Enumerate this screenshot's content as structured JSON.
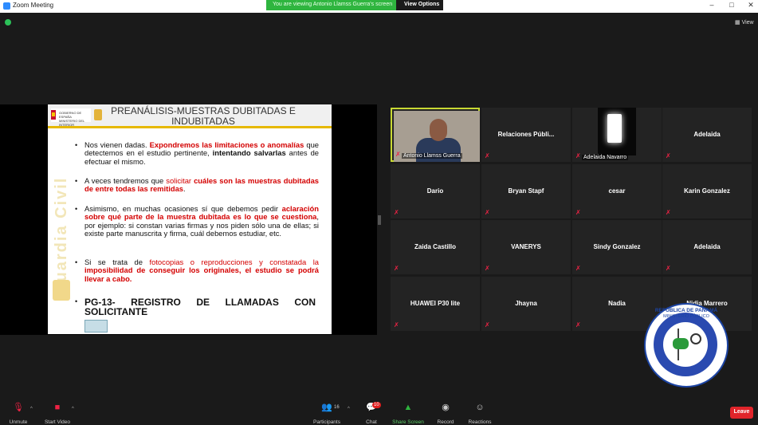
{
  "window": {
    "title": "Zoom Meeting"
  },
  "share_banner": {
    "text": "You are viewing Antonio Llamss Guerra's screen",
    "button": "View Options"
  },
  "gallery_toggle": "View",
  "slide": {
    "ministry": "GOBIERNO DE ESPAÑA MINISTERIO DEL INTERIOR",
    "title_line1": "PREANÁLISIS-MUESTRAS DUBITADAS E",
    "title_line2": "INDUBITADAS",
    "vertical_label": "Guardia Civil",
    "bullets": [
      {
        "parts": [
          {
            "t": "Nos vienen dadas. ",
            "s": ""
          },
          {
            "t": "Expondremos las limitaciones o anomalías",
            "s": "redb"
          },
          {
            "t": " que detectemos en el estudio pertinente, ",
            "s": ""
          },
          {
            "t": "intentando salvarlas",
            "s": "b"
          },
          {
            "t": " antes de efectuar el mismo.",
            "s": ""
          }
        ]
      },
      {
        "parts": [
          {
            "t": "A veces tendremos que ",
            "s": ""
          },
          {
            "t": "solicitar",
            "s": "red"
          },
          {
            "t": " ",
            "s": ""
          },
          {
            "t": "cuáles son las muestras dubitadas de entre todas las remitidas",
            "s": "redb"
          },
          {
            "t": ".",
            "s": ""
          }
        ]
      },
      {
        "parts": [
          {
            "t": "Asimismo, en muchas ocasiones sí que debemos pedir ",
            "s": ""
          },
          {
            "t": "aclaración sobre qué parte de la muestra dubitada es lo que se cuestiona",
            "s": "redb"
          },
          {
            "t": ", por ejemplo: si constan varias firmas y nos piden sólo una de ellas; si existe parte manuscrita y firma, cuál debemos estudiar, etc.",
            "s": ""
          }
        ]
      },
      {
        "parts": [
          {
            "t": "Si se trata de ",
            "s": ""
          },
          {
            "t": "fotocopias o reproducciones y constatada la",
            "s": "red"
          },
          {
            "t": " ",
            "s": ""
          },
          {
            "t": "imposibilidad de conseguir los originales, el estudio se podrá llevar a cabo.",
            "s": "redb"
          }
        ]
      }
    ],
    "pg_line": "PG-13- REGISTRO DE LLAMADAS CON SOLICITANTE",
    "bullet_char": "•"
  },
  "participants": [
    {
      "name": "Antonio Llamss Guerra",
      "video": true,
      "active": true
    },
    {
      "name": "Relaciones  Públi...",
      "video": false
    },
    {
      "name": "Adelaida Navarro",
      "video": true
    },
    {
      "name": "Adelaida",
      "video": false
    },
    {
      "name": "Dario",
      "video": false
    },
    {
      "name": "Bryan Stapf",
      "video": false
    },
    {
      "name": "cesar",
      "video": false
    },
    {
      "name": "Karin Gonzalez",
      "video": false
    },
    {
      "name": "Zaida Castillo",
      "video": false
    },
    {
      "name": "VANERYS",
      "video": false
    },
    {
      "name": "Sindy Gonzalez",
      "video": false
    },
    {
      "name": "Adelaida",
      "video": false
    },
    {
      "name": "HUAWEI P30 lite",
      "video": false
    },
    {
      "name": "Jhayna",
      "video": false
    },
    {
      "name": "Nadia",
      "video": false
    },
    {
      "name": "Nidia Marrero",
      "video": false
    }
  ],
  "seal": {
    "top": "REPÚBLICA DE PANAMÁ",
    "sub": "MINISTERIO PÚBLICO"
  },
  "toolbar": {
    "unmute": "Unmute",
    "start_video": "Start Video",
    "participants": "Participants",
    "participants_count": "16",
    "chat": "Chat",
    "chat_badge": "10",
    "share": "Share Screen",
    "record": "Record",
    "reactions": "Reactions",
    "leave": "Leave"
  },
  "colors": {
    "accent_green": "#2fb53f",
    "leave_red": "#e0242a",
    "active_border": "#c8d933",
    "slide_red": "#d40000"
  }
}
